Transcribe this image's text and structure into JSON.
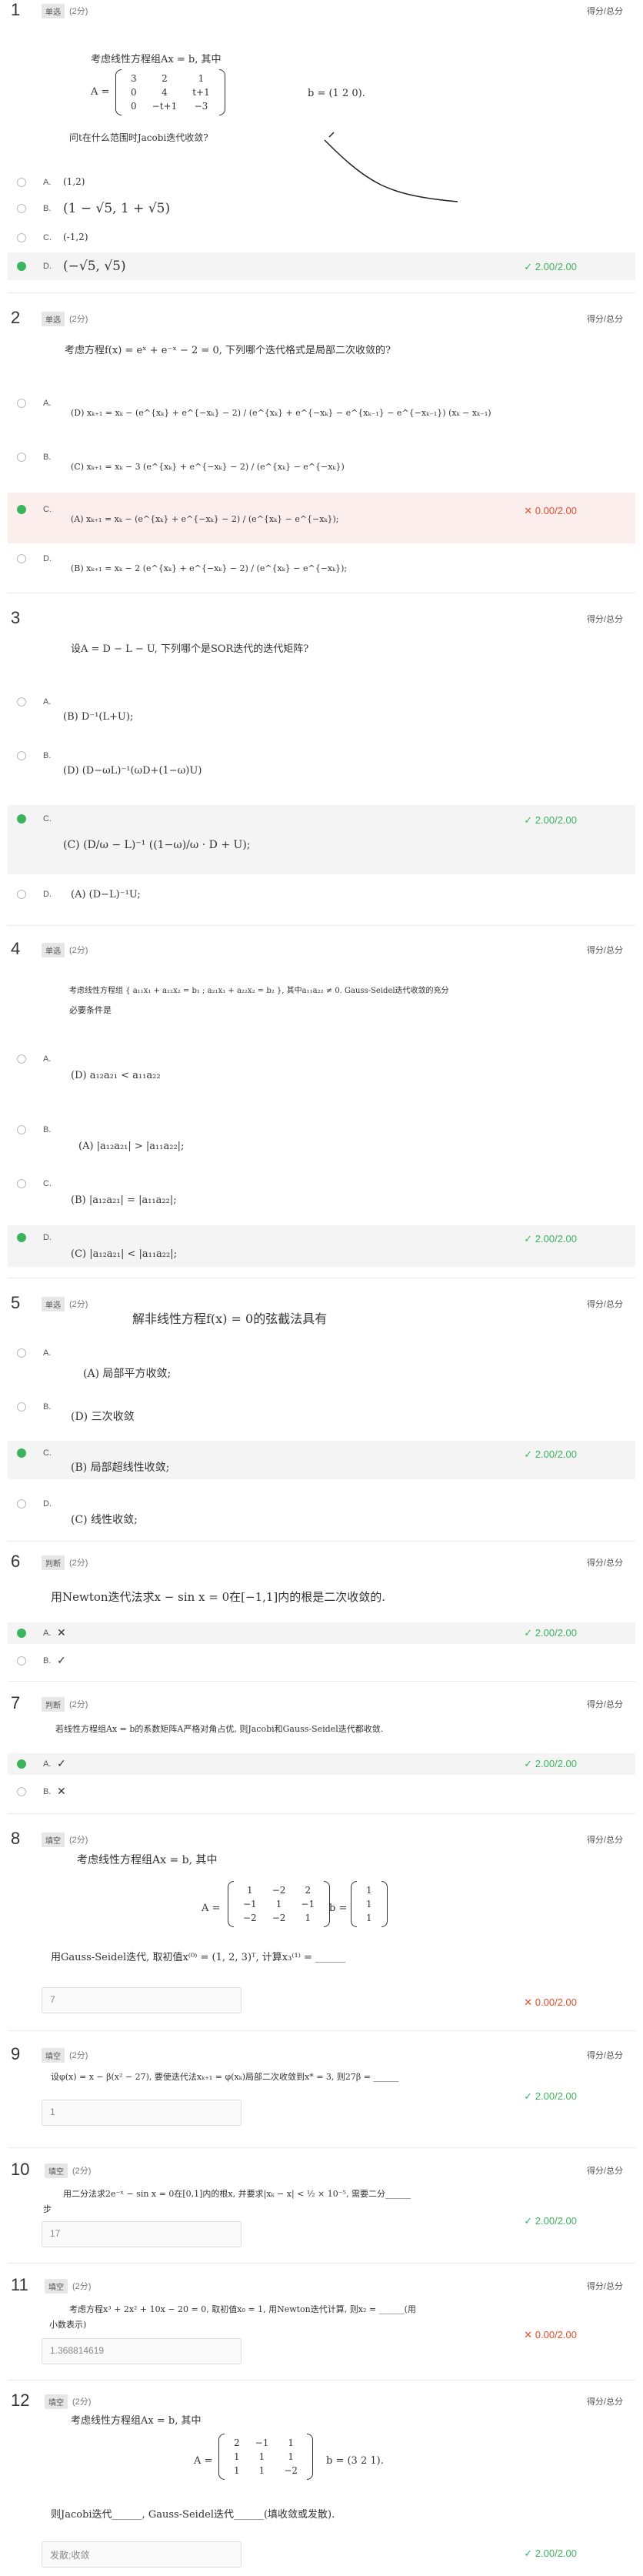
{
  "score_label": "得分/总分",
  "q1": {
    "num": "1",
    "type": "单选",
    "points": "(2分)",
    "stem_line1": "考虑线性方程组Ax = b, 其中",
    "stem_A": "A =",
    "matrix": [
      [
        "3",
        "2",
        "1"
      ],
      [
        "0",
        "4",
        "t+1"
      ],
      [
        "0",
        "−t+1",
        "−3"
      ]
    ],
    "stem_b": "b = (1  2  0).",
    "stem_line2": "问t在什么范围时Jacobi迭代收敛?",
    "options": [
      {
        "label": "A.",
        "text": "(1,2)"
      },
      {
        "label": "B.",
        "text": "(1 − √5, 1 + √5)"
      },
      {
        "label": "C.",
        "text": "(-1,2)"
      },
      {
        "label": "D.",
        "text": "(−√5, √5)"
      }
    ],
    "result": "2.00/2.00"
  },
  "q2": {
    "num": "2",
    "type": "单选",
    "points": "(2分)",
    "stem": "考虑方程f(x) = eˣ + e⁻ˣ − 2 = 0, 下列哪个迭代格式是局部二次收敛的?",
    "options": [
      {
        "label": "A.",
        "text": "(D) xₖ₊₁ = xₖ − (e^{xₖ} + e^{−xₖ} − 2) / (e^{xₖ} + e^{−xₖ} − e^{xₖ₋₁} − e^{−xₖ₋₁}) (xₖ − xₖ₋₁)"
      },
      {
        "label": "B.",
        "text": "(C) xₖ₊₁ = xₖ − 3 (e^{xₖ} + e^{−xₖ} − 2) / (e^{xₖ} − e^{−xₖ})"
      },
      {
        "label": "C.",
        "text": "(A) xₖ₊₁ = xₖ − (e^{xₖ} + e^{−xₖ} − 2) / (e^{xₖ} − e^{−xₖ});"
      },
      {
        "label": "D.",
        "text": "(B) xₖ₊₁ = xₖ − 2 (e^{xₖ} + e^{−xₖ} − 2) / (e^{xₖ} − e^{−xₖ});"
      }
    ],
    "result": "0.00/2.00"
  },
  "q3": {
    "num": "3",
    "type": "单选",
    "points": "(2分)",
    "stem": "设A = D − L − U, 下列哪个是SOR迭代的迭代矩阵?",
    "options": [
      {
        "label": "A.",
        "text": "(B) D⁻¹(L+U);"
      },
      {
        "label": "B.",
        "text": "(D) (D−ωL)⁻¹(ωD+(1−ω)U)"
      },
      {
        "label": "C.",
        "text": "(C) (D/ω − L)⁻¹ ((1−ω)/ω · D + U);"
      },
      {
        "label": "D.",
        "text": "(A) (D−L)⁻¹U;"
      }
    ],
    "result": "2.00/2.00"
  },
  "q4": {
    "num": "4",
    "type": "单选",
    "points": "(2分)",
    "stem_line1": "考虑线性方程组 { a₁₁x₁ + a₁₂x₂ = b₁ ; a₂₁x₁ + a₂₂x₂ = b₂ }, 其中a₁₁a₂₂ ≠ 0. Gauss-Seidel迭代收敛的充分",
    "stem_line2": "必要条件是",
    "options": [
      {
        "label": "A.",
        "text": "(D) a₁₂a₂₁ < a₁₁a₂₂"
      },
      {
        "label": "B.",
        "text": "(A) |a₁₂a₂₁| > |a₁₁a₂₂|;"
      },
      {
        "label": "C.",
        "text": "(B) |a₁₂a₂₁| = |a₁₁a₂₂|;"
      },
      {
        "label": "D.",
        "text": "(C) |a₁₂a₂₁| < |a₁₁a₂₂|;"
      }
    ],
    "result": "2.00/2.00"
  },
  "q5": {
    "num": "5",
    "type": "单选",
    "points": "(2分)",
    "stem": "解非线性方程f(x) = 0的弦截法具有",
    "options": [
      {
        "label": "A.",
        "text": "(A) 局部平方收敛;"
      },
      {
        "label": "B.",
        "text": "(D) 三次收敛"
      },
      {
        "label": "C.",
        "text": "(B) 局部超线性收敛;"
      },
      {
        "label": "D.",
        "text": "(C) 线性收敛;"
      }
    ],
    "result": "2.00/2.00"
  },
  "q6": {
    "num": "6",
    "type": "判断",
    "points": "(2分)",
    "stem": "用Newton迭代法求x − sin x = 0在[−1,1]内的根是二次收敛的.",
    "options": [
      {
        "label": "A.",
        "icon": "✕"
      },
      {
        "label": "B.",
        "icon": "✓"
      }
    ],
    "result": "2.00/2.00"
  },
  "q7": {
    "num": "7",
    "type": "判断",
    "points": "(2分)",
    "stem": "若线性方程组Ax = b的系数矩阵A严格对角占优, 则Jacobi和Gauss-Seidel迭代都收敛.",
    "options": [
      {
        "label": "A.",
        "icon": "✓"
      },
      {
        "label": "B.",
        "icon": "✕"
      }
    ],
    "result": "2.00/2.00"
  },
  "q8": {
    "num": "8",
    "type": "填空",
    "points": "(2分)",
    "stem_line1": "考虑线性方程组Ax = b, 其中",
    "stem_A": "A =",
    "matrix": [
      [
        "1",
        "−2",
        "2"
      ],
      [
        "−1",
        "1",
        "−1"
      ],
      [
        "−2",
        "−2",
        "1"
      ]
    ],
    "stem_b": "b =",
    "vector": [
      "1",
      "1",
      "1"
    ],
    "stem_line2": "用Gauss-Seidel迭代, 取初值x⁽⁰⁾ = (1, 2, 3)ᵀ, 计算x₃⁽¹⁾ = ______",
    "answer": "7",
    "result": "0.00/2.00"
  },
  "q9": {
    "num": "9",
    "type": "填空",
    "points": "(2分)",
    "stem": "设φ(x) = x − β(x² − 27), 要使迭代法xₖ₊₁ = φ(xₖ)局部二次收敛到x* = 3, 则27β = ______",
    "answer": "1",
    "result": "2.00/2.00"
  },
  "q10": {
    "num": "10",
    "type": "填空",
    "points": "(2分)",
    "stem_line1": "用二分法求2e⁻ˣ − sin x = 0在[0,1]内的根x, 并要求|xₖ − x| < ½ × 10⁻⁵, 需要二分______",
    "stem_line2": "步",
    "answer": "17",
    "result": "2.00/2.00"
  },
  "q11": {
    "num": "11",
    "type": "填空",
    "points": "(2分)",
    "stem_line1": "考虑方程x³ + 2x² + 10x − 20 = 0, 取初值x₀ = 1, 用Newton迭代计算, 则x₂ = ______(用",
    "stem_line2": "小数表示)",
    "answer": "1.368814619",
    "result": "0.00/2.00"
  },
  "q12": {
    "num": "12",
    "type": "填空",
    "points": "(2分)",
    "stem_line1": "考虑线性方程组Ax = b, 其中",
    "stem_A": "A =",
    "matrix": [
      [
        "2",
        "−1",
        "1"
      ],
      [
        "1",
        "1",
        "1"
      ],
      [
        "1",
        "1",
        "−2"
      ]
    ],
    "stem_b": "b = (3  2  1).",
    "stem_line2": "则Jacobi迭代______, Gauss-Seidel迭代______(填收敛或发散).",
    "answer": "发散;收敛",
    "result": "2.00/2.00"
  }
}
